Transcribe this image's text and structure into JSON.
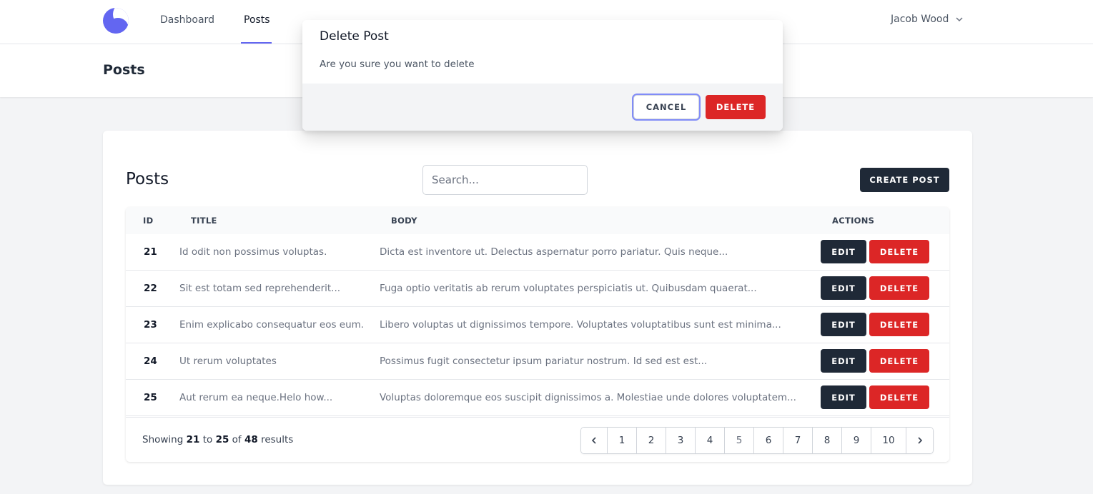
{
  "nav": {
    "logo": "logo-icon",
    "links": [
      {
        "label": "Dashboard",
        "active": false
      },
      {
        "label": "Posts",
        "active": true
      }
    ],
    "user": "Jacob Wood",
    "accent": "#6366f1"
  },
  "header": {
    "title": "Posts"
  },
  "card": {
    "title": "Posts",
    "search_placeholder": "Search...",
    "create_label": "CREATE POST"
  },
  "table": {
    "columns": [
      "ID",
      "TITLE",
      "BODY",
      "ACTIONS"
    ],
    "rows": [
      {
        "id": "21",
        "title": "Id odit non possimus voluptas.",
        "body": "Dicta est inventore ut. Delectus aspernatur porro pariatur. Quis neque..."
      },
      {
        "id": "22",
        "title": "Sit est totam sed reprehenderit...",
        "body": "Fuga optio veritatis ab rerum voluptates perspiciatis ut. Quibusdam quaerat..."
      },
      {
        "id": "23",
        "title": "Enim explicabo consequatur eos eum.",
        "body": "Libero voluptas ut dignissimos tempore. Voluptates voluptatibus sunt est minima..."
      },
      {
        "id": "24",
        "title": "Ut rerum voluptates",
        "body": "Possimus fugit consectetur ipsum pariatur nostrum. Id sed est est..."
      },
      {
        "id": "25",
        "title": "Aut rerum ea neque.Helo how...",
        "body": "Voluptas doloremque eos suscipit dignissimos a. Molestiae unde dolores voluptatem..."
      }
    ],
    "edit_label": "EDIT",
    "delete_label": "DELETE"
  },
  "pagination": {
    "showing_prefix": "Showing",
    "from": "21",
    "to_word": "to",
    "to": "25",
    "of_word": "of",
    "total": "48",
    "results_word": "results",
    "pages": [
      "1",
      "2",
      "3",
      "4",
      "5",
      "6",
      "7",
      "8",
      "9",
      "10"
    ],
    "current": "5"
  },
  "modal": {
    "title": "Delete Post",
    "message": "Are you sure you want to delete",
    "cancel_label": "CANCEL",
    "delete_label": "DELETE"
  },
  "colors": {
    "danger": "#dc2626",
    "dark": "#1f2937",
    "focus_ring": "#818cf8"
  }
}
